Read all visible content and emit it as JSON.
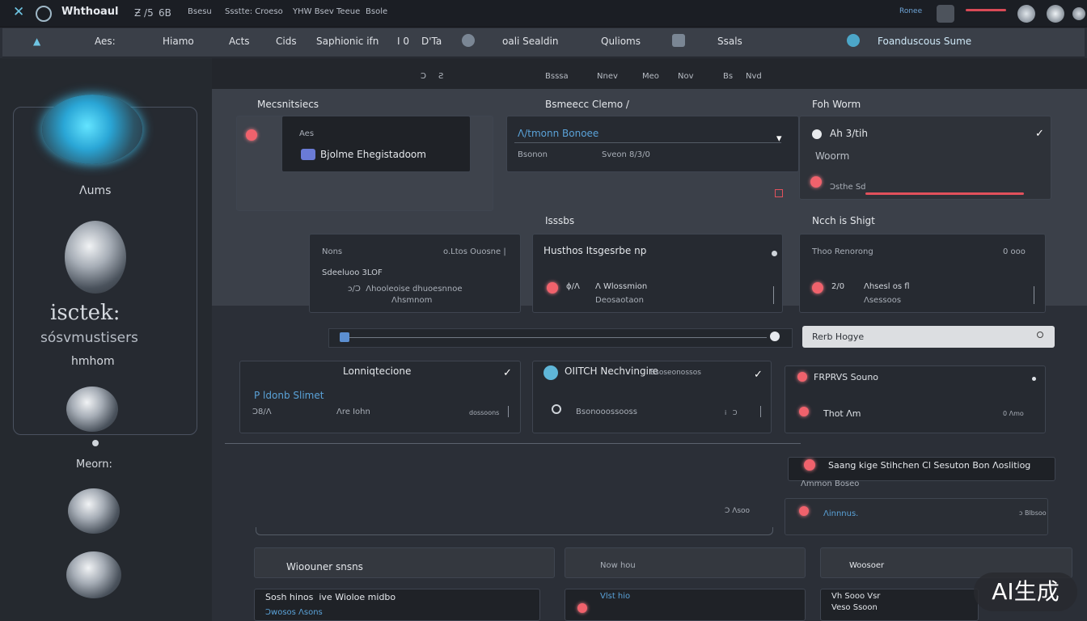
{
  "titlebar": {
    "brand": "Whthoaul",
    "items": [
      "Ƶ /5",
      "6B",
      "Bsesu",
      "Ssstte: Croeso",
      "YHW Bsev Teeue",
      "Bsole"
    ],
    "right_label": "Ronee"
  },
  "menubar": {
    "items": [
      "Aes:",
      "Hiamo",
      "Acts",
      "Cids",
      "Saphionic ifn",
      "I 0",
      "D'Ta",
      "oali Sealdin",
      "Qulioms",
      "Ssals"
    ],
    "search_label": "Foanduscous Sume"
  },
  "subbar": [
    "Ɔ",
    "Ƨ",
    "Bsssa",
    "Nnev",
    "Meo",
    "Nov",
    "Bs",
    "Nvd"
  ],
  "sidebar": {
    "label1": "Ʌums",
    "title": "isctek:",
    "subtitle": "sósvmustisers",
    "label2": "hmhom",
    "label3": "Meorn:"
  },
  "sections": {
    "s1_title": "Mecsnitsiecs",
    "s2_title": "Bsmeecc Clemo /",
    "s3_title": "Foh Worm",
    "s4_title": "Isssbs",
    "s5_title": "Ncch is Shigt"
  },
  "cards": {
    "c1_small": "Aes",
    "c1_main": "Bjolme Ehegistadoom",
    "c2_title": "Ʌ/tmonn Bonoee",
    "c2_left": "Bsonon",
    "c2_right": "Sveon 8/3/0",
    "c3_title": "Ah 3/tih",
    "c3_sub": "Woorm",
    "c3_bottom": "Ɔsthe Sd",
    "c4_title": "Nons",
    "c4_right": "o.Ltos Ouosne |",
    "c4_mid": "Sdeeluoo 3LOF",
    "c4_line1": "ɔ/Ɔ  Ʌhooleoise dhuoesnnoe",
    "c4_line2": "Ʌhsmnom",
    "c5_title": "Husthos Itsgesrbe np",
    "c5_mid_a": "ɸ/Ʌ",
    "c5_mid_b": "Ʌ Wlossmion",
    "c5_line2": "Deosaotaon",
    "c6_title": "Thoo Renorong",
    "c6_right": "0 ooo",
    "c6_mid_a": "2/0",
    "c6_mid_b": "Ʌhsesl os fl",
    "c6_line2": "Ʌsessoos"
  },
  "search": {
    "placeholder": "Rerb Hogye"
  },
  "row2": {
    "r1_title": "Lonniqtecione",
    "r1_blue": "P ldonb Slimet",
    "r1_left": "Ɔ8/Ʌ",
    "r1_mid": "Ʌre Iohn",
    "r1_right": "dossoons",
    "r2_title": "OIITCH Nechvingire",
    "r2_sub": "Bsoseonossos",
    "r2_mid": "Bsonooossooss",
    "r2_right": "i   Ɔ",
    "r3_title": "FRPRVS Souno",
    "r3_mid": "Thot Ʌm",
    "r3_right": "0 Ʌmo"
  },
  "right_col": {
    "b1": "Saang kige Stihchen Cl Sesuton Bon Ʌoslitiog",
    "b1_sub": "Ʌmmon Boseo",
    "b2": "Ʌinnnus.",
    "b2_right": "ɔ Blbsoo",
    "b_left_small": "Ɔ Ʌsoo"
  },
  "bottom": {
    "t1": "Wioouner snsns",
    "t2": "Now hou",
    "t3": "Woosoer",
    "row_a": "Sosh hinos  ive Wioloe midbo",
    "row_a_sub": "Ɔwosos Ʌsons",
    "row_b": "Vlst hio",
    "row_c": "Vh Sooo Vsr",
    "row_c_sub": "Veso Ssoon"
  },
  "watermark": "AI生成"
}
